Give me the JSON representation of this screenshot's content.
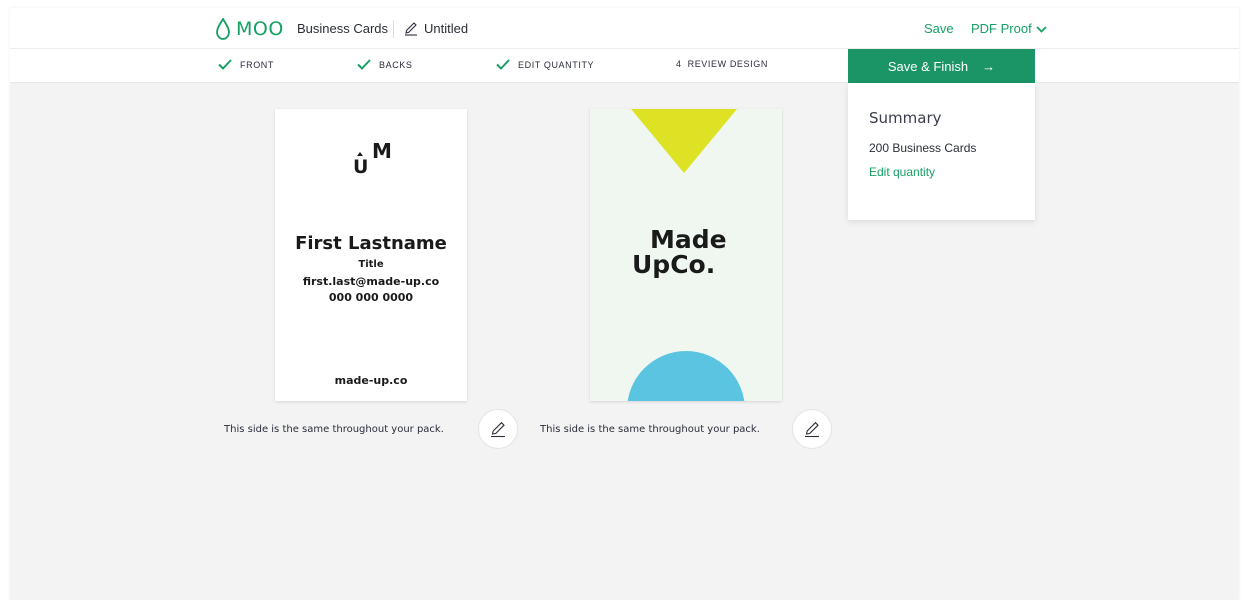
{
  "header": {
    "brand": "MOO",
    "product": "Business Cards",
    "doc_title": "Untitled",
    "save_label": "Save",
    "proof_label": "PDF Proof"
  },
  "steps": [
    {
      "label": "FRONT",
      "done": true
    },
    {
      "label": "BACKS",
      "done": true
    },
    {
      "label": "EDIT QUANTITY",
      "done": true
    },
    {
      "number": "4",
      "label": "REVIEW DESIGN",
      "done": false
    }
  ],
  "cta": {
    "label": "Save & Finish",
    "arrow": "→"
  },
  "summary": {
    "title": "Summary",
    "quantity": "200 Business Cards",
    "edit_label": "Edit quantity"
  },
  "front_card": {
    "logo_letters": "UM",
    "name": "First Lastname",
    "title": "Title",
    "email": "first.last@made-up.co",
    "phone": "000 000 0000",
    "website": "made-up.co"
  },
  "back_card": {
    "brand_line1": "Made",
    "brand_line2": "UpCo.",
    "triangle_color": "#dde324",
    "circle_color": "#5bc5e1",
    "bg_color": "#eff7f0"
  },
  "captions": {
    "front": "This side is the same throughout your pack.",
    "back": "This side is the same throughout your pack."
  },
  "colors": {
    "accent": "#16a064",
    "cta": "#1b9565"
  },
  "icons": {
    "brand": "drop-icon",
    "title_edit": "pencil-icon",
    "dropdown": "chevron-down-icon",
    "step_done": "check-icon",
    "card_edit": "pencil-icon"
  }
}
